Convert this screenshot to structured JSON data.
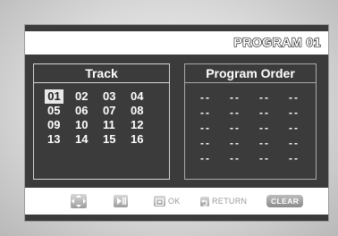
{
  "header": {
    "title": "PROGRAM 01"
  },
  "track_panel": {
    "heading": "Track",
    "tracks": [
      "01",
      "02",
      "03",
      "04",
      "05",
      "06",
      "07",
      "08",
      "09",
      "10",
      "11",
      "12",
      "13",
      "14",
      "15",
      "16"
    ],
    "selected": "01"
  },
  "program_panel": {
    "heading": "Program Order",
    "slots": [
      "--",
      "--",
      "--",
      "--",
      "--",
      "--",
      "--",
      "--",
      "--",
      "--",
      "--",
      "--",
      "--",
      "--",
      "--",
      "--",
      "--",
      "--",
      "--",
      "--"
    ]
  },
  "footer": {
    "ok_label": "OK",
    "return_label": "RETURN",
    "clear_label": "CLEAR"
  },
  "icons": [
    "directional-pad-icon",
    "play-pause-icon",
    "enter-icon",
    "return-icon"
  ],
  "colors": {
    "screen_bg": "#3b3b3b",
    "bar_bg": "#ffffff",
    "selected_bg": "#e8e8e8"
  }
}
